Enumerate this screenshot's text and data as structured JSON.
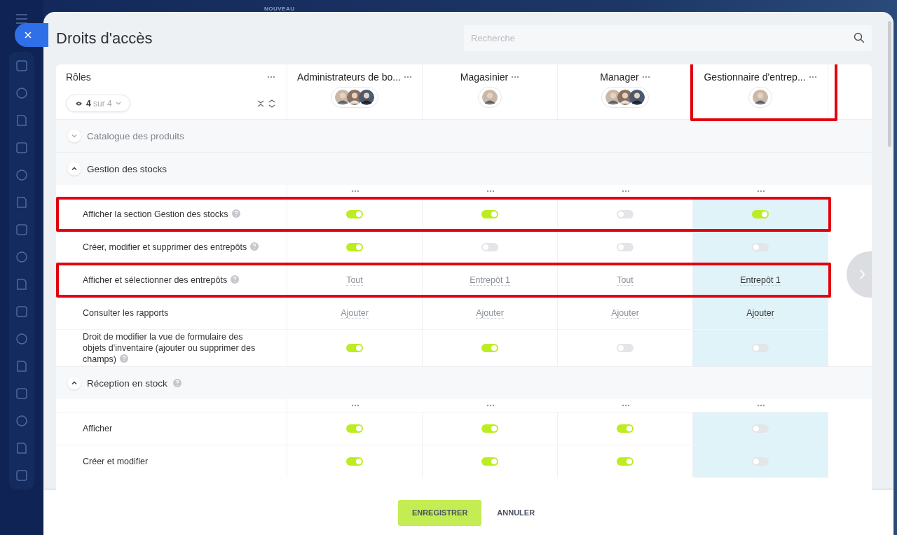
{
  "top_label": "NOUVEAU",
  "title": "Droits d'accès",
  "search": {
    "placeholder": "Recherche"
  },
  "roles_header": {
    "label": "Rôles",
    "filter": "**4** sur 4"
  },
  "columns": [
    {
      "name": "Administrateurs de bo...",
      "selected": false,
      "highlighted": false
    },
    {
      "name": "Magasinier",
      "selected": false,
      "highlighted": false
    },
    {
      "name": "Manager",
      "selected": false,
      "highlighted": false
    },
    {
      "name": "Gestionnaire d'entrep...",
      "selected": true,
      "highlighted": true
    }
  ],
  "sections": [
    {
      "title": "Catalogue des produits",
      "expanded": false,
      "help": false
    },
    {
      "title": "Gestion des stocks",
      "expanded": true,
      "help": false,
      "rows": [
        {
          "label": "Afficher la section Gestion des stocks",
          "help": true,
          "highlighted": true,
          "cells": [
            {
              "kind": "toggle",
              "on": true
            },
            {
              "kind": "toggle",
              "on": true
            },
            {
              "kind": "toggle",
              "on": false
            },
            {
              "kind": "toggle",
              "on": true
            }
          ]
        },
        {
          "label": "Créer, modifier et supprimer des entrepôts",
          "help": true,
          "highlighted": false,
          "cells": [
            {
              "kind": "toggle",
              "on": true
            },
            {
              "kind": "toggle",
              "on": false
            },
            {
              "kind": "toggle",
              "on": false
            },
            {
              "kind": "toggle",
              "on": false
            }
          ]
        },
        {
          "label": "Afficher et sélectionner des entrepôts",
          "help": true,
          "highlighted": true,
          "cells": [
            {
              "kind": "link",
              "text": "Tout"
            },
            {
              "kind": "link",
              "text": "Entrepôt 1"
            },
            {
              "kind": "link",
              "text": "Tout"
            },
            {
              "kind": "link",
              "text": "Entrepôt 1"
            }
          ]
        },
        {
          "label": "Consulter les rapports",
          "help": false,
          "highlighted": false,
          "cells": [
            {
              "kind": "link",
              "text": "Ajouter"
            },
            {
              "kind": "link",
              "text": "Ajouter"
            },
            {
              "kind": "link",
              "text": "Ajouter"
            },
            {
              "kind": "link",
              "text": "Ajouter"
            }
          ]
        },
        {
          "label": "Droit de modifier la vue de formulaire des objets d'inventaire (ajouter ou supprimer des champs)",
          "help": true,
          "highlighted": false,
          "cells": [
            {
              "kind": "toggle",
              "on": true
            },
            {
              "kind": "toggle",
              "on": true
            },
            {
              "kind": "toggle",
              "on": false
            },
            {
              "kind": "toggle",
              "on": false
            }
          ]
        }
      ]
    },
    {
      "title": "Réception en stock",
      "expanded": true,
      "help": true,
      "rows": [
        {
          "label": "Afficher",
          "help": false,
          "highlighted": false,
          "cells": [
            {
              "kind": "toggle",
              "on": true
            },
            {
              "kind": "toggle",
              "on": true
            },
            {
              "kind": "toggle",
              "on": true
            },
            {
              "kind": "toggle",
              "on": false
            }
          ]
        },
        {
          "label": "Créer et modifier",
          "help": false,
          "highlighted": false,
          "cells": [
            {
              "kind": "toggle",
              "on": true
            },
            {
              "kind": "toggle",
              "on": true
            },
            {
              "kind": "toggle",
              "on": true
            },
            {
              "kind": "toggle",
              "on": false
            }
          ]
        }
      ]
    }
  ],
  "footer": {
    "save": "ENREGISTRER",
    "cancel": "ANNULER"
  }
}
